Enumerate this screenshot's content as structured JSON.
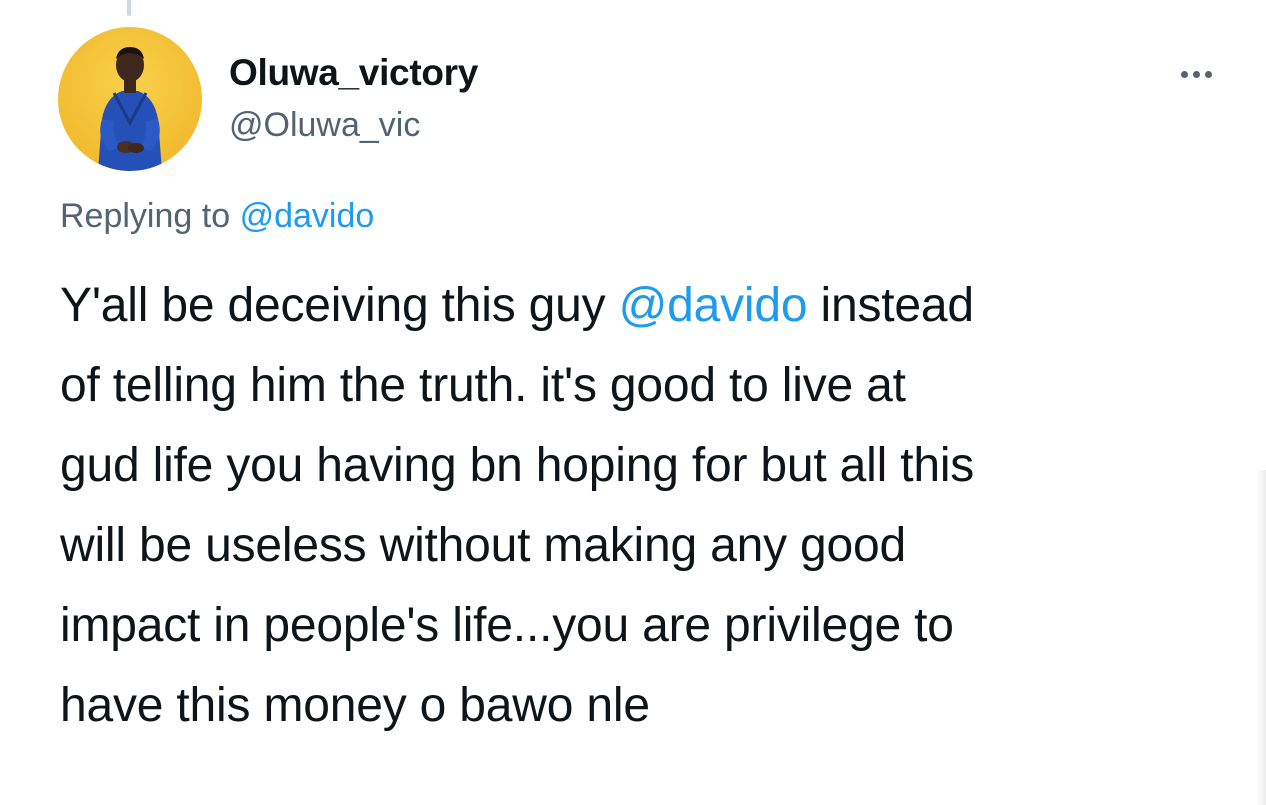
{
  "tweet": {
    "author": {
      "display_name": "Oluwa_victory",
      "handle": "@Oluwa_vic",
      "avatar_icon": "profile-photo"
    },
    "more_icon": "more-horizontal-icon",
    "reply_context": {
      "prefix": "Replying to",
      "mention": "@davido"
    },
    "body": {
      "line1_before": "Y'all be deceiving this guy ",
      "line1_mention": "@davido",
      "line1_after": " instead",
      "line2": "of telling him the truth. it's good to live at",
      "line3": "gud life you having bn hoping for but all this",
      "line4": "will be useless without making any good",
      "line5": "impact in people's life...you are privilege to",
      "line6": "have this money o bawo nle"
    }
  },
  "colors": {
    "text_primary": "#0f1419",
    "text_secondary": "#536471",
    "link": "#1d9bf0",
    "avatar_background": "#f5c33b",
    "avatar_outfit": "#2450b8"
  }
}
